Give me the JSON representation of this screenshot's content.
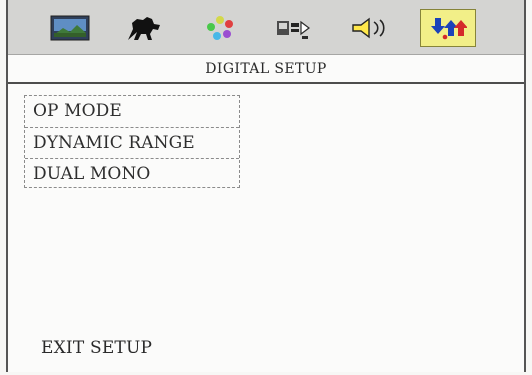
{
  "toolbar": {
    "icons": [
      {
        "name": "picture-icon",
        "selected": false
      },
      {
        "name": "horse-icon",
        "selected": false
      },
      {
        "name": "color-icon",
        "selected": false
      },
      {
        "name": "tv-icon",
        "selected": false
      },
      {
        "name": "speaker-icon",
        "selected": false
      },
      {
        "name": "digital-setup-icon",
        "selected": true
      }
    ]
  },
  "header": {
    "title": "DIGITAL SETUP"
  },
  "menu": {
    "items": [
      {
        "label": "OP MODE"
      },
      {
        "label": "DYNAMIC RANGE"
      },
      {
        "label": "DUAL MONO"
      }
    ]
  },
  "footer": {
    "exit_label": "EXIT SETUP"
  },
  "colors": {
    "toolbar_background": "#d4d4d2",
    "selected_highlight": "#f2ef88",
    "menu_border": "#8b8b8b"
  }
}
